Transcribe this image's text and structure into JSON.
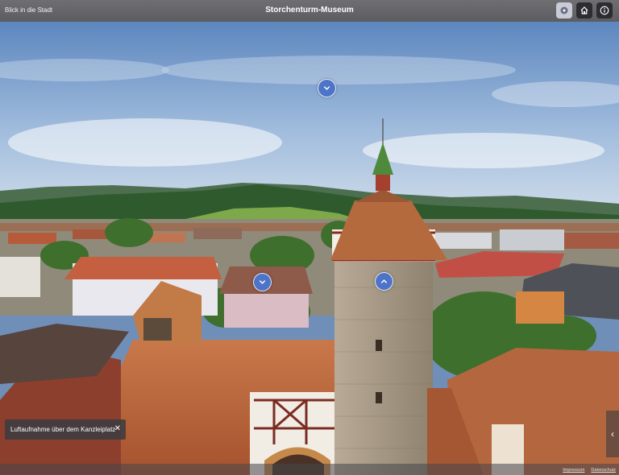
{
  "header": {
    "left_link": "Blick in die Stadt",
    "title": "Storchenturm-Museum"
  },
  "toolbar": {
    "buttons": [
      {
        "icon": "share-icon"
      },
      {
        "icon": "home-icon"
      },
      {
        "icon": "info-icon"
      }
    ]
  },
  "hotspots": [
    {
      "icon": "chevron-down-icon"
    },
    {
      "icon": "chevron-down-icon"
    },
    {
      "icon": "chevron-up-icon"
    }
  ],
  "caption": {
    "text": "Luftaufnahme über dem Kanzleiplatz",
    "close": "✕"
  },
  "side_arrow": "‹",
  "footer": {
    "links": [
      "Impressum",
      "Datenschutz"
    ]
  },
  "colors": {
    "hotspot": "#4d74c8",
    "topbar": "#5f5f63",
    "sky": "#6f93c4",
    "roof": "#b8623a"
  }
}
